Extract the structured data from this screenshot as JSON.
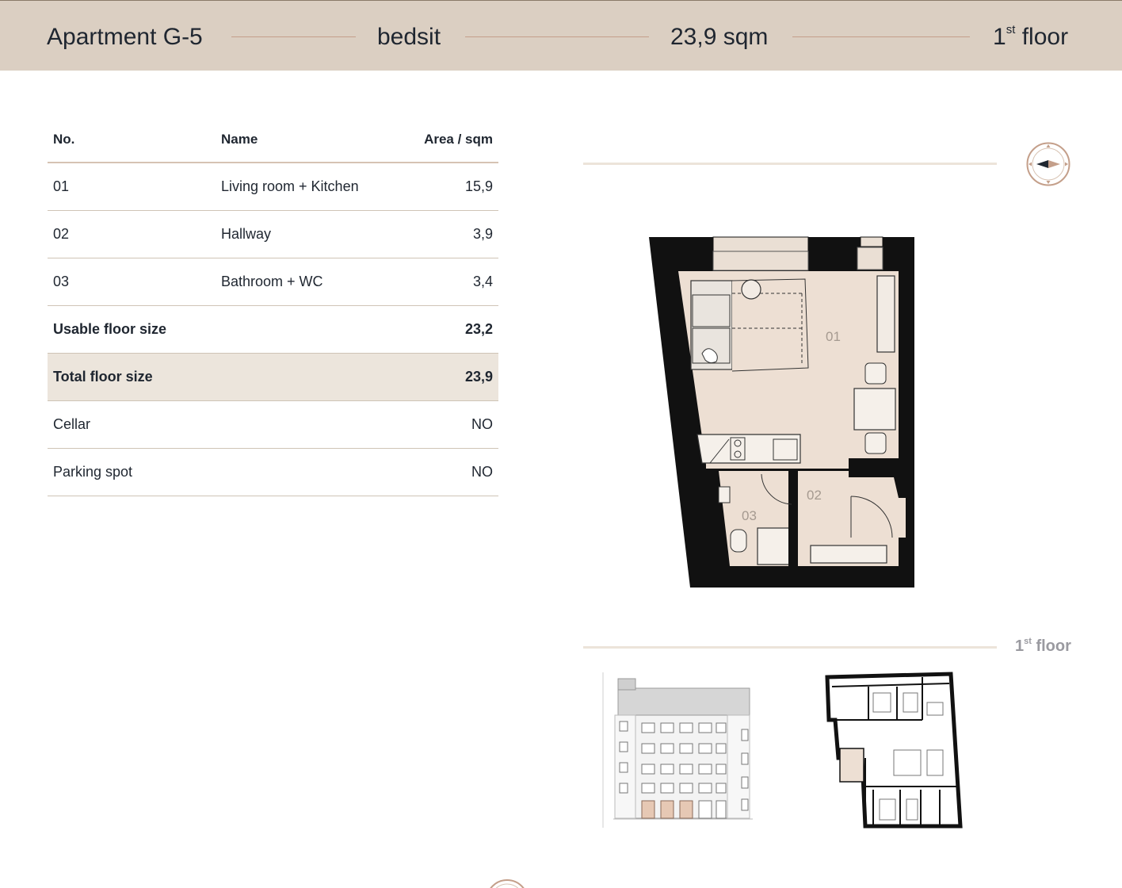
{
  "header": {
    "apartment": "Apartment G-5",
    "type": "bedsit",
    "area": "23,9 sqm",
    "floor_num": "1",
    "floor_sup": "st",
    "floor_word": "floor"
  },
  "table": {
    "col_no": "No.",
    "col_name": "Name",
    "col_area": "Area / sqm",
    "rows": [
      {
        "no": "01",
        "name": "Living room + Kitchen",
        "area": "15,9"
      },
      {
        "no": "02",
        "name": "Hallway",
        "area": "3,9"
      },
      {
        "no": "03",
        "name": "Bathroom + WC",
        "area": "3,4"
      }
    ],
    "usable_label": "Usable floor size",
    "usable_value": "23,2",
    "total_label": "Total floor size",
    "total_value": "23,9",
    "cellar_label": "Cellar",
    "cellar_value": "NO",
    "parking_label": "Parking spot",
    "parking_value": "NO"
  },
  "plan": {
    "room1": "01",
    "room2": "02",
    "room3": "03"
  },
  "floor_label": {
    "num": "1",
    "sup": "st",
    "word": "floor"
  },
  "icons": {
    "compass": "compass-icon"
  },
  "colors": {
    "header_bg": "#dbcfc2",
    "room_fill": "#eddfd3",
    "total_row_bg": "#ece5dc",
    "accent_line": "#c49f8a"
  }
}
